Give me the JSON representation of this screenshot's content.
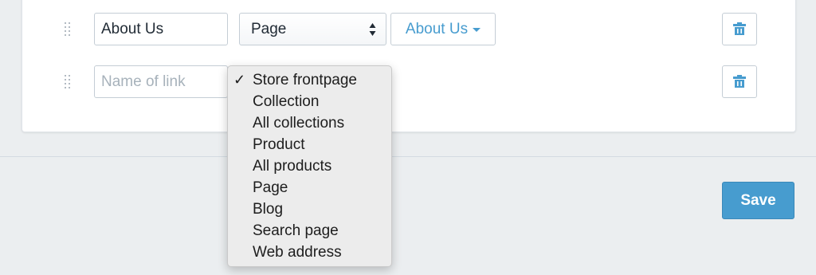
{
  "rows": [
    {
      "name_value": "About Us",
      "name_placeholder": "",
      "type_label": "Page",
      "target_label": "About Us"
    },
    {
      "name_value": "",
      "name_placeholder": "Name of link"
    }
  ],
  "link_type_menu": {
    "selected": "Store frontpage",
    "options": [
      "Store frontpage",
      "Collection",
      "All collections",
      "Product",
      "All products",
      "Page",
      "Blog",
      "Search page",
      "Web address"
    ]
  },
  "footer": {
    "save_label": "Save"
  },
  "icons": {
    "drag_handle": "drag-handle-icon",
    "delete": "trash-icon",
    "select_arrows": "updown-arrows-icon",
    "caret": "caret-down-icon",
    "check": "checkmark-icon"
  },
  "colors": {
    "accent": "#479ccf",
    "background": "#ebeef0",
    "card": "#ffffff"
  }
}
